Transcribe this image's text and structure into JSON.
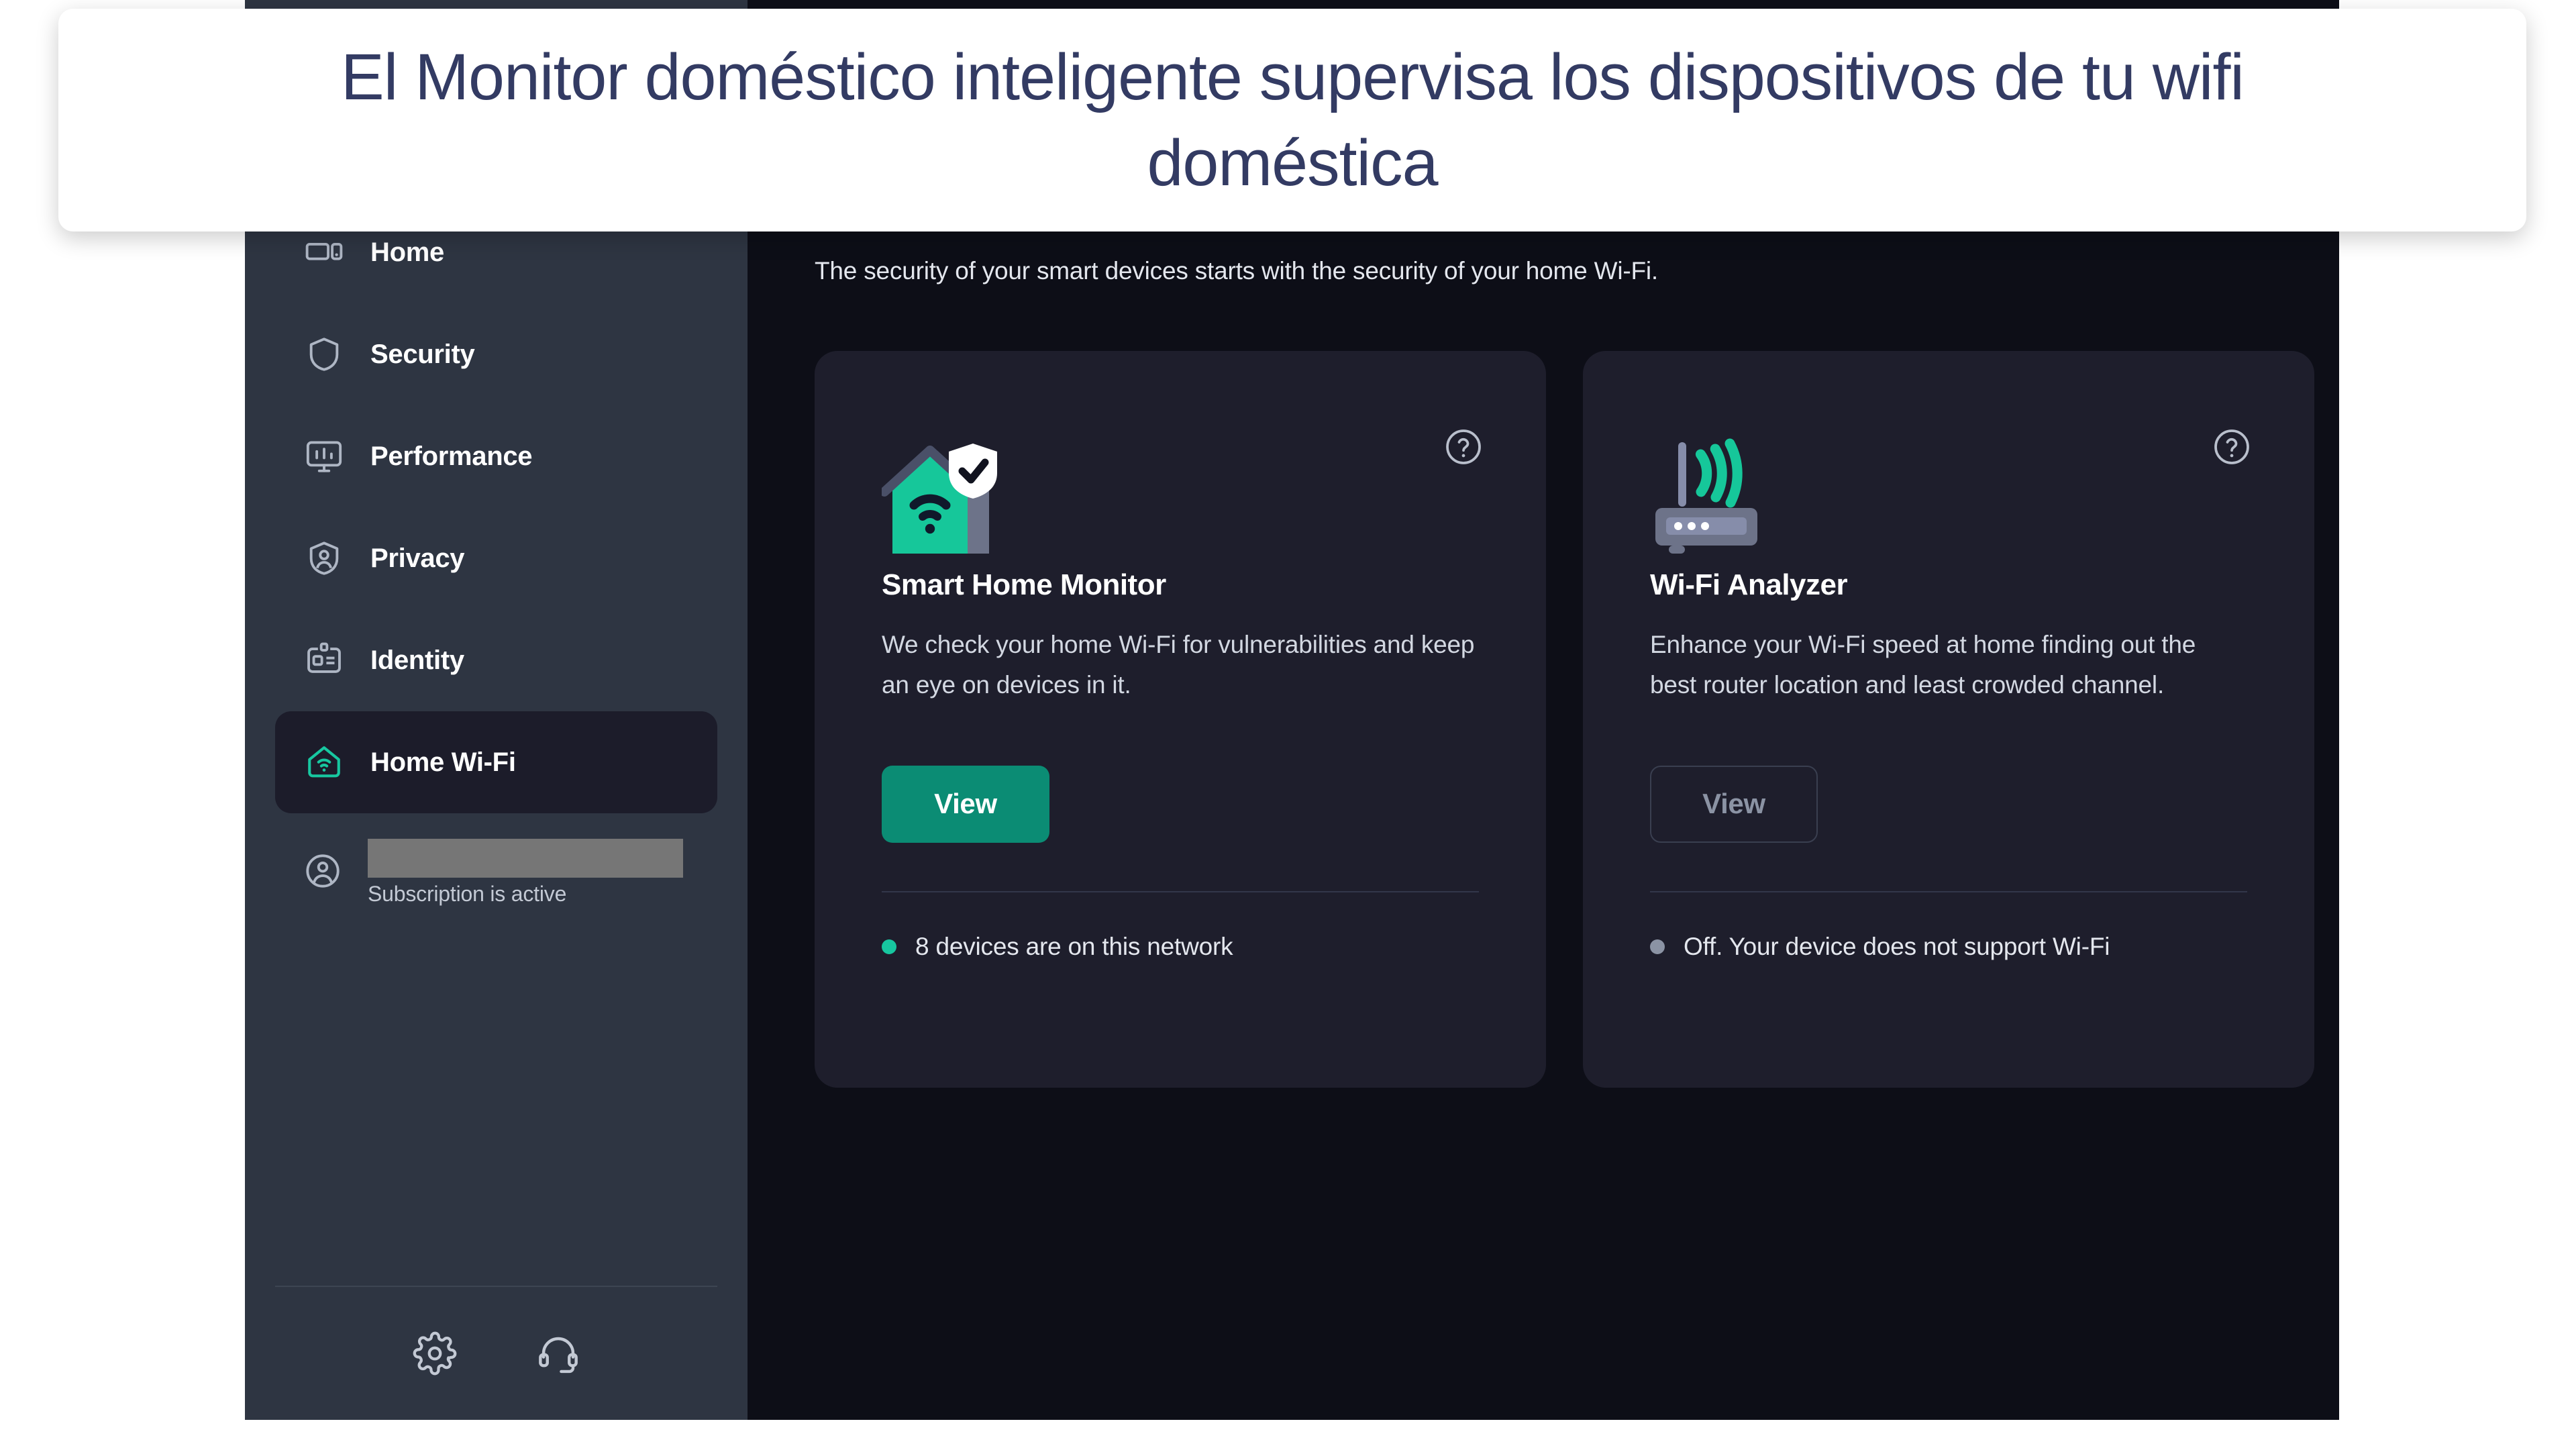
{
  "caption": {
    "text": "El Monitor doméstico inteligente supervisa los dispositivos de tu wifi doméstica"
  },
  "colors": {
    "accent_green": "#17c7a0",
    "button_green": "#0b8c74",
    "sidebar_bg": "#2e3542",
    "main_bg": "#0d0e17",
    "card_bg": "#1e1e2c",
    "active_nav_bg": "#1c1c2a",
    "caption_text": "#333b63",
    "status_off_grey": "#8b93a4"
  },
  "sidebar": {
    "items": [
      {
        "label": "Home",
        "icon": "monitor-home-icon",
        "active": false
      },
      {
        "label": "Security",
        "icon": "shield-icon",
        "active": false
      },
      {
        "label": "Performance",
        "icon": "performance-icon",
        "active": false
      },
      {
        "label": "Privacy",
        "icon": "privacy-icon",
        "active": false
      },
      {
        "label": "Identity",
        "icon": "id-badge-icon",
        "active": false
      },
      {
        "label": "Home Wi-Fi",
        "icon": "home-wifi-icon",
        "active": true
      }
    ],
    "account": {
      "icon": "account-avatar-icon",
      "name_redacted": true,
      "subscription_status": "Subscription is active"
    },
    "footer": {
      "settings_icon": "gear-icon",
      "support_icon": "headset-icon"
    }
  },
  "main": {
    "subtitle": "The security of your smart devices starts with the security of your home Wi-Fi.",
    "cards": [
      {
        "id": "smart-home-monitor",
        "illustration": "house-wifi-shield-check-icon",
        "help_icon": "question-circle-icon",
        "title": "Smart Home Monitor",
        "description": "We check your home Wi-Fi for vulnerabilities and keep an eye on devices in it.",
        "button_label": "View",
        "button_style": "primary",
        "status_text": "8 devices are on this network",
        "status_dot_color": "#17c7a0"
      },
      {
        "id": "wifi-analyzer",
        "illustration": "router-signal-icon",
        "help_icon": "question-circle-icon",
        "title": "Wi-Fi Analyzer",
        "description": "Enhance your Wi-Fi speed at home finding out the best router location and least crowded channel.",
        "button_label": "View",
        "button_style": "secondary",
        "status_text": "Off. Your device does not support Wi-Fi",
        "status_dot_color": "#8b93a4"
      }
    ]
  }
}
